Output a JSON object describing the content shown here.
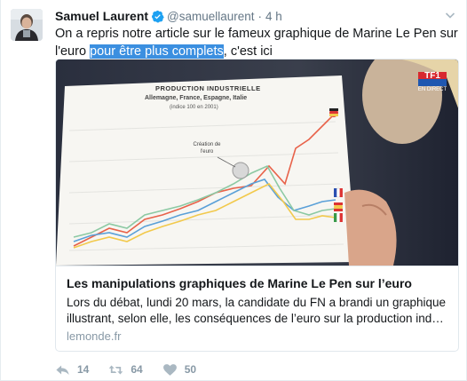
{
  "tweet": {
    "author_name": "Samuel Laurent",
    "handle": "@samuellaurent",
    "separator": "·",
    "time": "4 h",
    "text_before": "On a repris notre article sur le fameux graphique de Marine Le Pen sur l'euro ",
    "link_text": "pour être plus complets",
    "text_after": ", c'est ici"
  },
  "card": {
    "title": "Les manipulations graphiques de Marine Le Pen sur l’euro",
    "desc_line1": "Lors du débat, lundi 20 mars, la candidate du FN a brandi un graphique",
    "desc_line2": "illustrant, selon elle, les conséquences de l’euro sur la production industri…",
    "domain": "lemonde.fr",
    "image": {
      "chart_title": "PRODUCTION INDUSTRIELLE",
      "chart_subtitle": "Allemagne, France, Espagne, Italie",
      "chart_note": "(indice 100 en 2001)",
      "annotation": "Création de l'euro",
      "tv_logo": "TF1",
      "tv_live": "EN DIRECT"
    }
  },
  "actions": {
    "reply_count": "14",
    "retweet_count": "64",
    "like_count": "50"
  },
  "colors": {
    "link_highlight": "#3b8fe0",
    "verified": "#1da1f2",
    "muted": "#8899a6",
    "line_germany": "#e8624a",
    "line_france": "#5aa0d8",
    "line_italy": "#8cc9a3",
    "line_spain": "#f2c94c"
  }
}
